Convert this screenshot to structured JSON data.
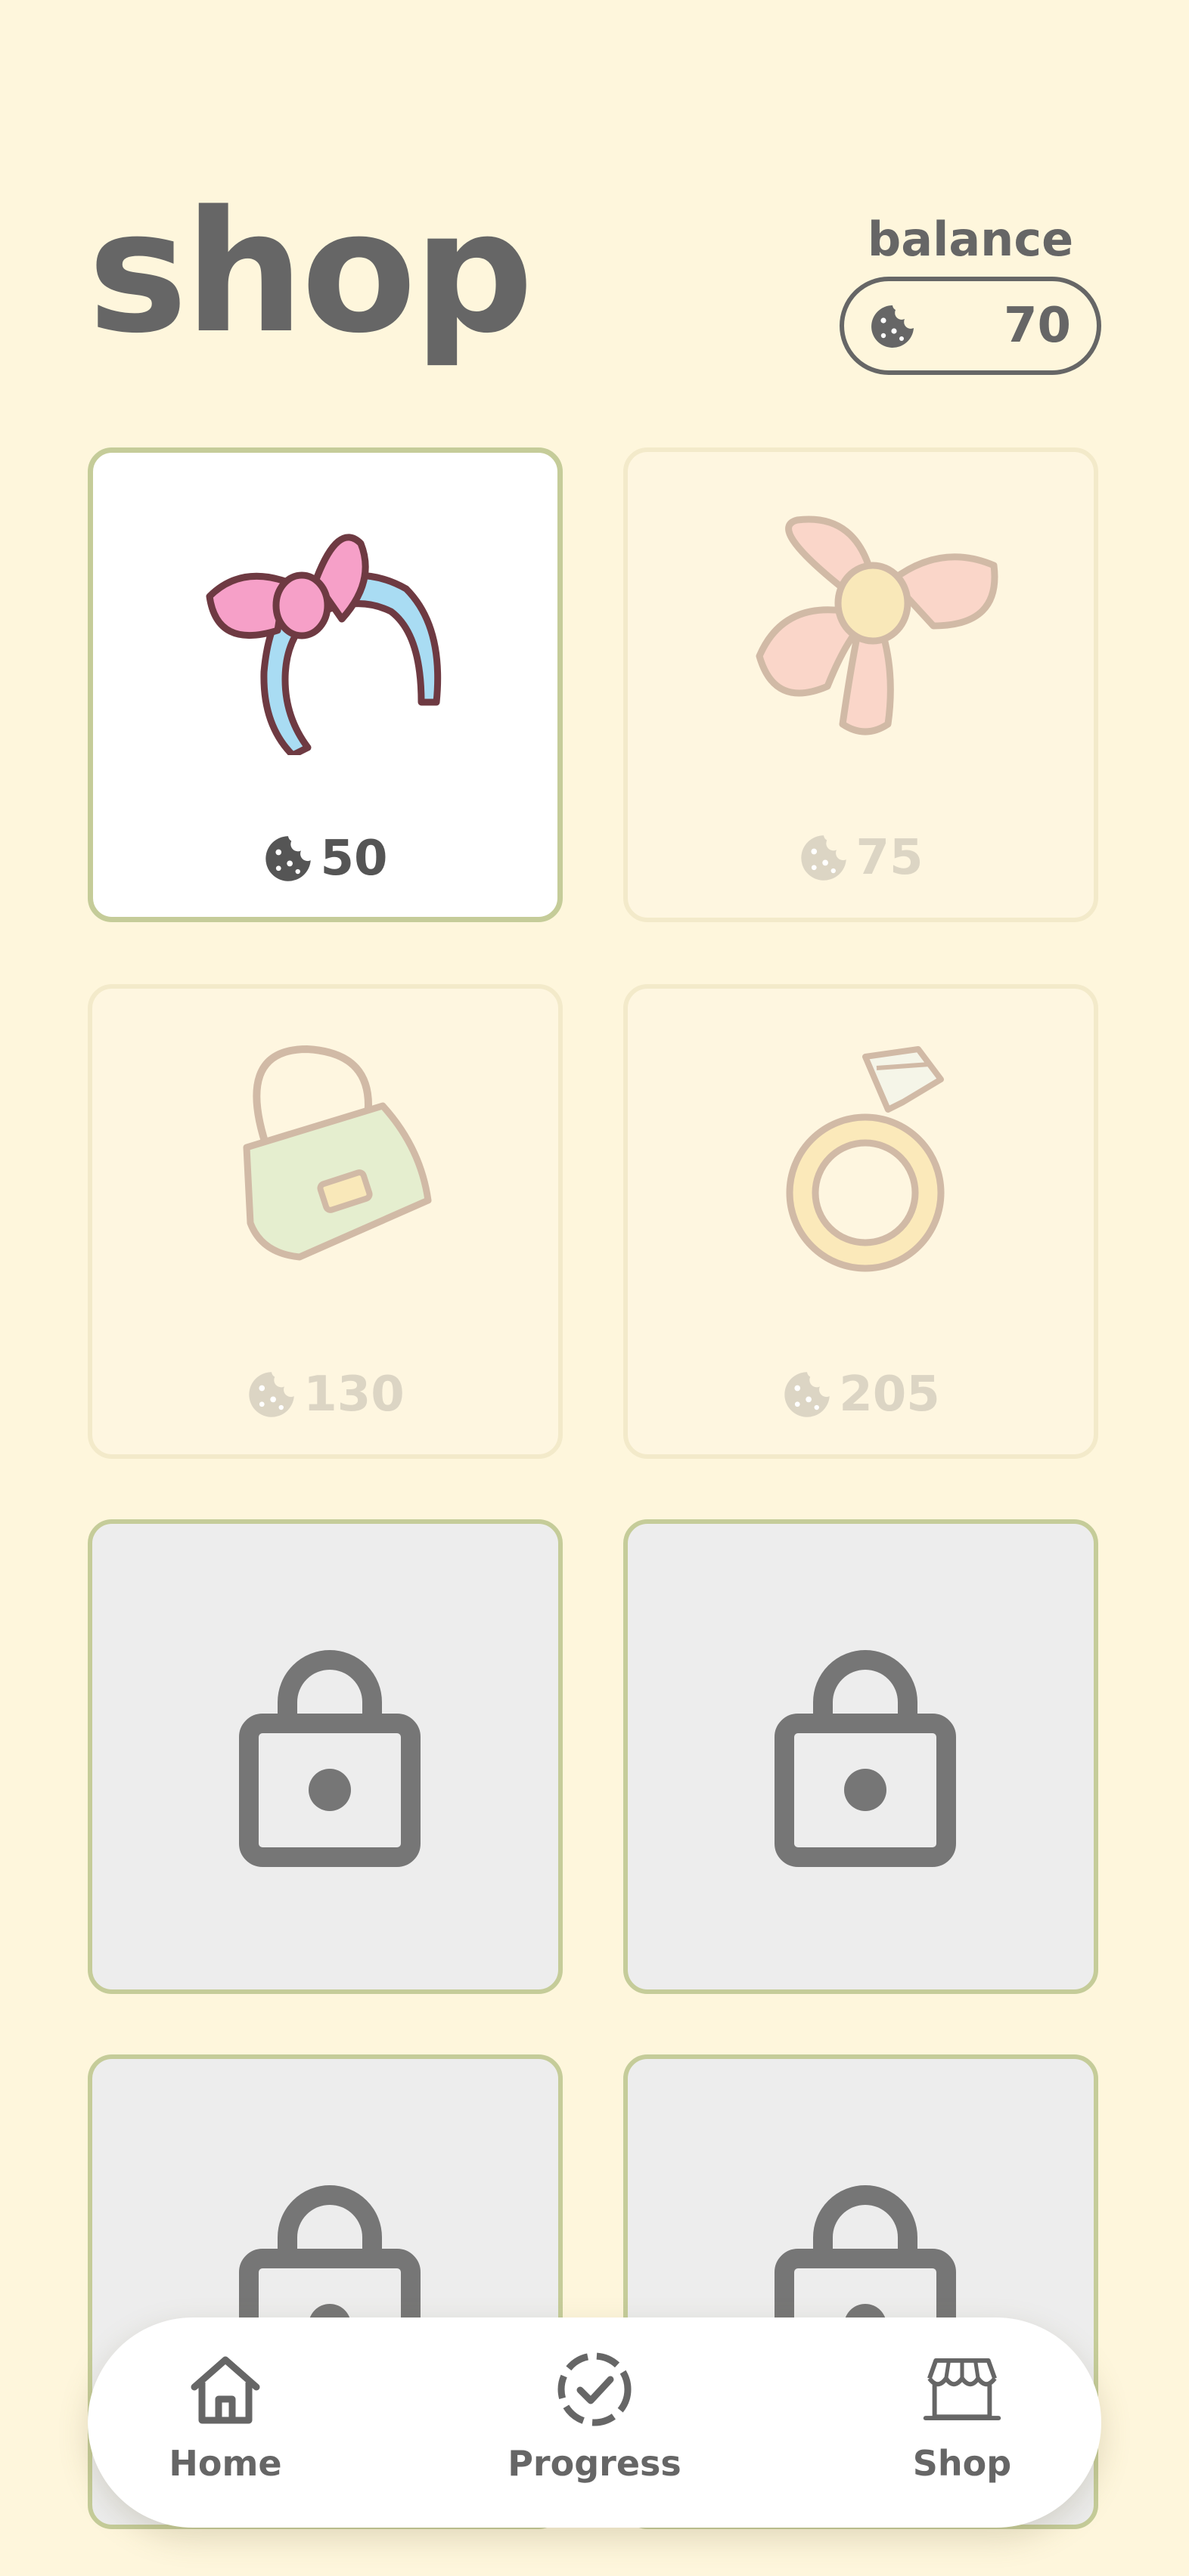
{
  "header": {
    "title": "shop"
  },
  "balance": {
    "label": "balance",
    "amount": "70",
    "icon": "cookie-icon"
  },
  "shop": {
    "items": [
      {
        "name": "headband",
        "price": "50",
        "state": "owned"
      },
      {
        "name": "bow",
        "price": "75",
        "state": "unaffordable"
      },
      {
        "name": "handbag",
        "price": "130",
        "state": "unaffordable"
      },
      {
        "name": "ring",
        "price": "205",
        "state": "unaffordable"
      },
      {
        "name": "locked-1",
        "state": "locked"
      },
      {
        "name": "locked-2",
        "state": "locked"
      },
      {
        "name": "locked-3",
        "state": "locked"
      },
      {
        "name": "locked-4",
        "state": "locked"
      }
    ]
  },
  "nav": {
    "items": [
      {
        "label": "Home",
        "icon": "home-icon"
      },
      {
        "label": "Progress",
        "icon": "progress-icon"
      },
      {
        "label": "Shop",
        "icon": "shop-icon"
      }
    ]
  },
  "colors": {
    "background": "#FEF6DC",
    "text": "#666666",
    "card_border": "#C5CC99",
    "locked_card": "#EDEDED"
  }
}
